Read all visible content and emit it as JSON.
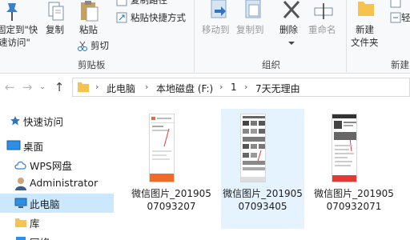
{
  "ribbon": {
    "pin_label_line1": "固定到\"快",
    "pin_label_line2": "速访问\"",
    "copy": "复制",
    "paste": "粘贴",
    "copy_path": "复制路径",
    "paste_shortcut": "粘贴快捷方式",
    "cut": "剪切",
    "clipboard_group": "剪贴板",
    "move_to": "移动到",
    "copy_to": "复制到",
    "delete": "删除",
    "rename": "重命名",
    "organize_group": "组织",
    "new_folder_line1": "新建",
    "new_folder_line2": "文件夹",
    "easy_access": "轻",
    "new_group": "新建"
  },
  "address": {
    "crumbs": [
      "此电脑",
      "本地磁盘 (F:)",
      "1",
      "7天无理由"
    ]
  },
  "sidebar": {
    "items": [
      {
        "label": "快速访问",
        "icon": "star-icon"
      },
      {
        "label": "桌面",
        "icon": "desktop-icon"
      },
      {
        "label": "WPS网盘",
        "icon": "cloud-icon"
      },
      {
        "label": "Administrator",
        "icon": "user-icon"
      },
      {
        "label": "此电脑",
        "icon": "computer-icon",
        "selected": true
      },
      {
        "label": "库",
        "icon": "library-icon"
      },
      {
        "label": "网络",
        "icon": "network-icon"
      }
    ]
  },
  "files": [
    {
      "name": "微信图片_2019050709320 7",
      "display": "微信图片_20190507093207",
      "selected": false
    },
    {
      "name": "微信图片_20190507093405",
      "display": "微信图片_20190507093405",
      "selected": true
    },
    {
      "name": "微信图片_201905070932071",
      "display": "微信图片_201905070932071",
      "selected": false
    }
  ],
  "colors": {
    "accent_blue": "#1979ca",
    "selected_bg": "#cce8ff",
    "hover_bg": "#e5f3ff",
    "folder_yellow": "#f6c44e"
  }
}
